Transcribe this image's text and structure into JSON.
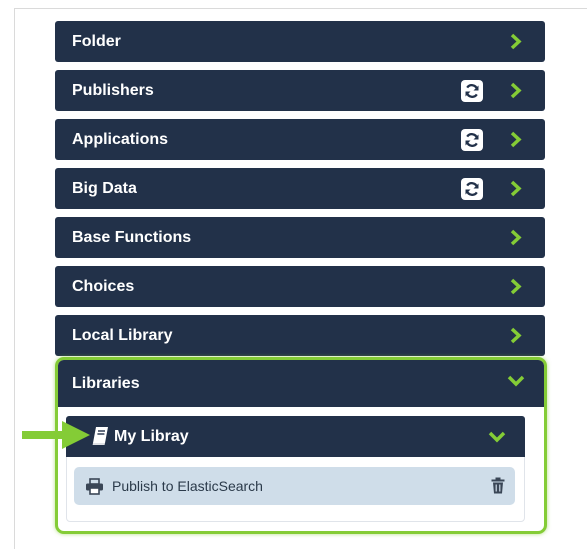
{
  "panels": [
    {
      "label": "Folder",
      "refresh": false
    },
    {
      "label": "Publishers",
      "refresh": true
    },
    {
      "label": "Applications",
      "refresh": true
    },
    {
      "label": "Big Data",
      "refresh": true
    },
    {
      "label": "Base Functions",
      "refresh": false
    },
    {
      "label": "Choices",
      "refresh": false
    },
    {
      "label": "Local Library",
      "refresh": false
    }
  ],
  "libraries": {
    "label": "Libraries",
    "my_library": {
      "label": "My Libray",
      "items": [
        {
          "label": "Publish to ElasticSearch",
          "icon": "printer-icon",
          "action_icon": "trash-icon"
        }
      ]
    }
  },
  "colors": {
    "panel_bg": "#223149",
    "chevron": "#84cc36",
    "highlight": "#84cc36",
    "item_bg": "#cfdde9"
  }
}
